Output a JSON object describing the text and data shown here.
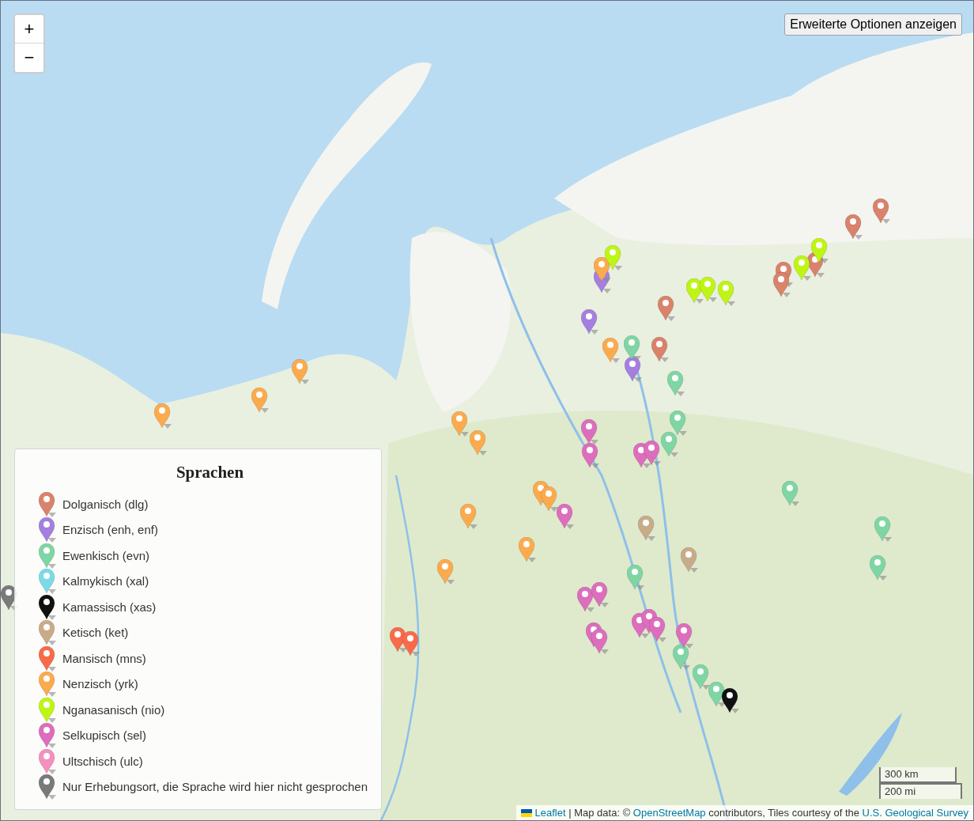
{
  "zoom_controls": [
    {
      "label": "+"
    },
    {
      "label": "−"
    }
  ],
  "options_button": {
    "label": "Erweiterte Optionen anzeigen"
  },
  "legend": {
    "title": "Sprachen",
    "items": [
      {
        "label": "Dolganisch (dlg)",
        "color": "#d9826c"
      },
      {
        "label": "Enzisch (enh, enf)",
        "color": "#a47fe0"
      },
      {
        "label": "Ewenkisch (evn)",
        "color": "#7fd6a4"
      },
      {
        "label": "Kalmykisch (xal)",
        "color": "#7cd9e6"
      },
      {
        "label": "Kamassisch (xas)",
        "color": "#111111"
      },
      {
        "label": "Ketisch (ket)",
        "color": "#c8ab88"
      },
      {
        "label": "Mansisch (mns)",
        "color": "#f96a4a"
      },
      {
        "label": "Nenzisch (yrk)",
        "color": "#fbab4e"
      },
      {
        "label": "Nganasanisch (nio)",
        "color": "#bff514"
      },
      {
        "label": "Selkupisch (sel)",
        "color": "#dd6ebd"
      },
      {
        "label": "Ultschisch (ulc)",
        "color": "#f48fbe"
      },
      {
        "label": "Nur Erhebungsort, die Sprache wird hier nicht gesprochen",
        "color": "#7a7a7a"
      }
    ]
  },
  "scale": [
    "300 km",
    "200 mi"
  ],
  "attribution": {
    "parts": [
      {
        "kind": "link",
        "text": "Leaflet"
      },
      {
        "kind": "text",
        "text": " | Map data: © "
      },
      {
        "kind": "link",
        "text": "OpenStreetMap"
      },
      {
        "kind": "text",
        "text": " contributors, Tiles courtesy of the "
      },
      {
        "kind": "link",
        "text": "U.S. Geological Survey"
      }
    ]
  }
}
